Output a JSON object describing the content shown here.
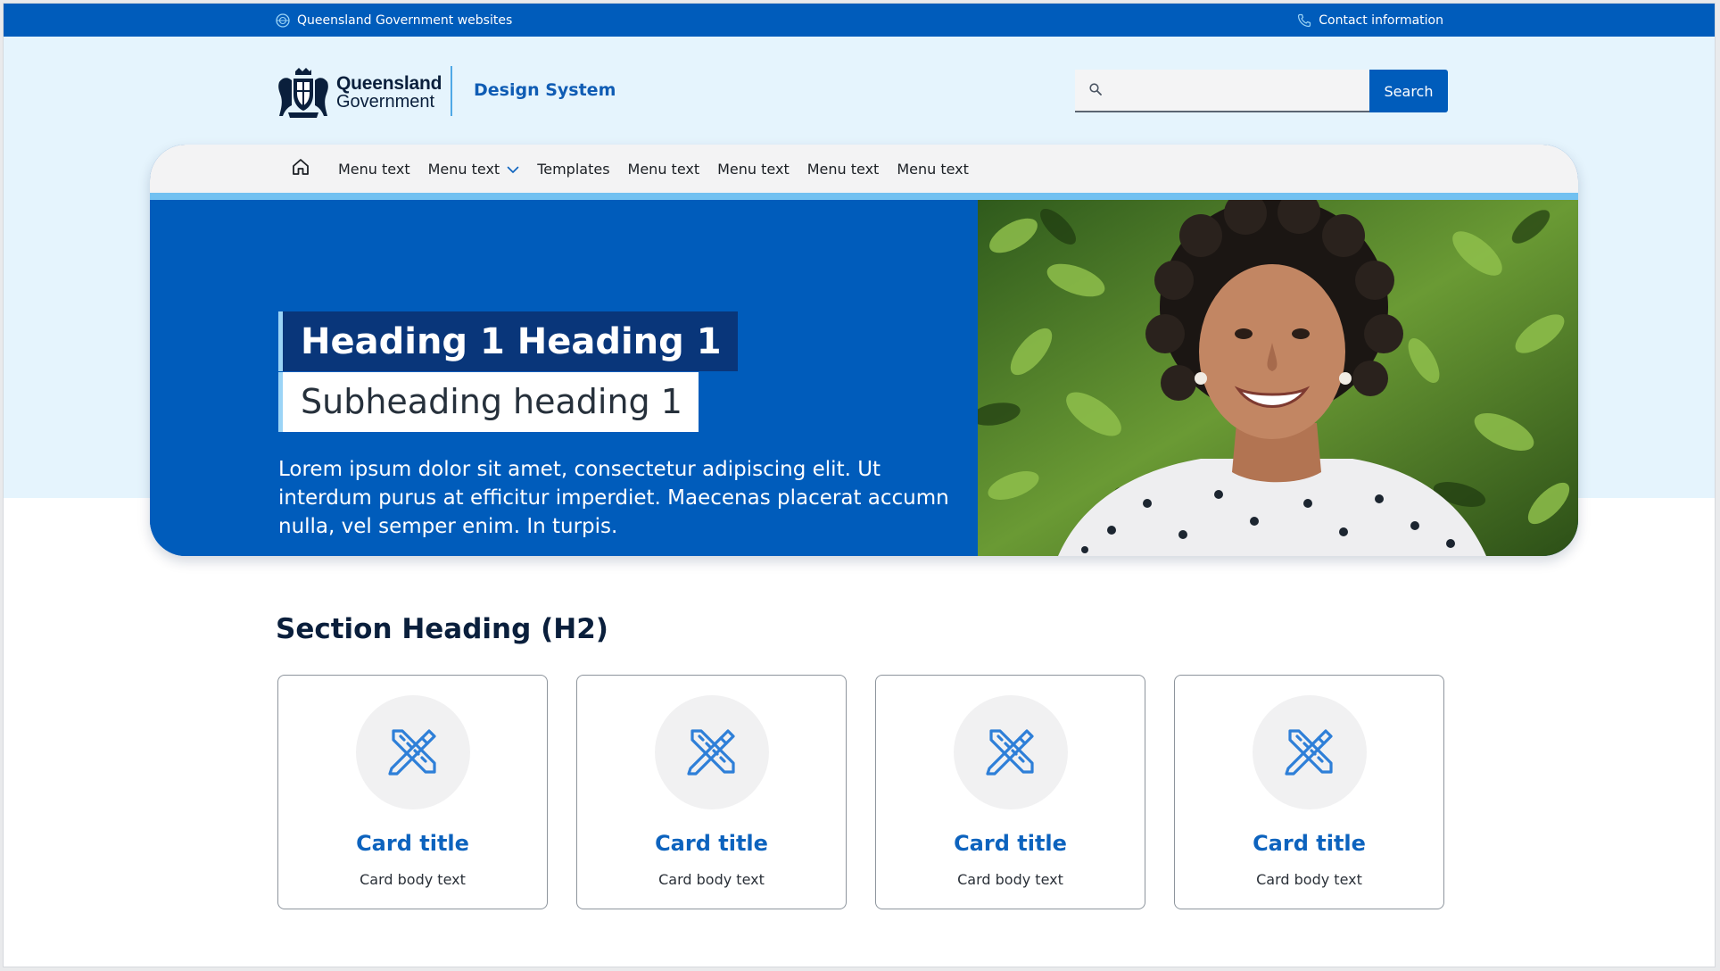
{
  "gov_bar": {
    "left_label": "Queensland Government websites",
    "right_label": "Contact information",
    "left_icon": "globe-icon",
    "right_icon": "phone-icon"
  },
  "header": {
    "logo_line1": "Queensland",
    "logo_line2": "Government",
    "site_name": "Design System",
    "search": {
      "placeholder": "",
      "value": "",
      "button_label": "Search",
      "icon": "search-icon"
    }
  },
  "nav": {
    "home_icon": "home-icon",
    "items": [
      {
        "label": "Menu text"
      },
      {
        "label": "Menu text",
        "has_dropdown": true
      },
      {
        "label": "Templates"
      },
      {
        "label": "Menu text"
      },
      {
        "label": "Menu text"
      },
      {
        "label": "Menu text"
      },
      {
        "label": "Menu text"
      }
    ]
  },
  "hero": {
    "heading": "Heading 1 Heading 1",
    "subheading": "Subheading heading 1",
    "body": "Lorem ipsum dolor sit amet, consectetur adipiscing elit. Ut interdum purus at efficitur imperdiet. Maecenas placerat accumn nulla, vel semper enim. In turpis."
  },
  "section": {
    "heading": "Section Heading (H2)",
    "cards": [
      {
        "title": "Card title",
        "body": "Card body text",
        "icon": "pencil-ruler-icon"
      },
      {
        "title": "Card title",
        "body": "Card body text",
        "icon": "pencil-ruler-icon"
      },
      {
        "title": "Card title",
        "body": "Card body text",
        "icon": "pencil-ruler-icon"
      },
      {
        "title": "Card title",
        "body": "Card body text",
        "icon": "pencil-ruler-icon"
      }
    ]
  },
  "colors": {
    "primary": "#005cbb",
    "dark_blue": "#09367a",
    "light_band": "#e5f4fd",
    "accent_light_blue": "#72c1f1",
    "card_title": "#0d63be"
  }
}
